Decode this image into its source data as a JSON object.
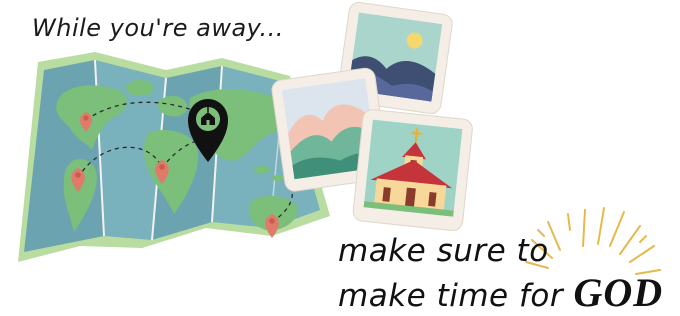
{
  "headline": "While you're away...",
  "tagline": {
    "line1": "make sure to",
    "line2_prefix": "make time for ",
    "emphasis": "GOD"
  },
  "icons": [
    "world-map",
    "church-location-pin",
    "mountain-photo",
    "sun-landscape-photo",
    "church-photo",
    "radiant-burst"
  ],
  "colors": {
    "ocean": "#6aa6b2",
    "land": "#7cbf7a",
    "map_border": "#b9dca0",
    "pin": "#e07a6b",
    "photo_frame": "#f4eee7",
    "burst": "#e6b94a"
  }
}
